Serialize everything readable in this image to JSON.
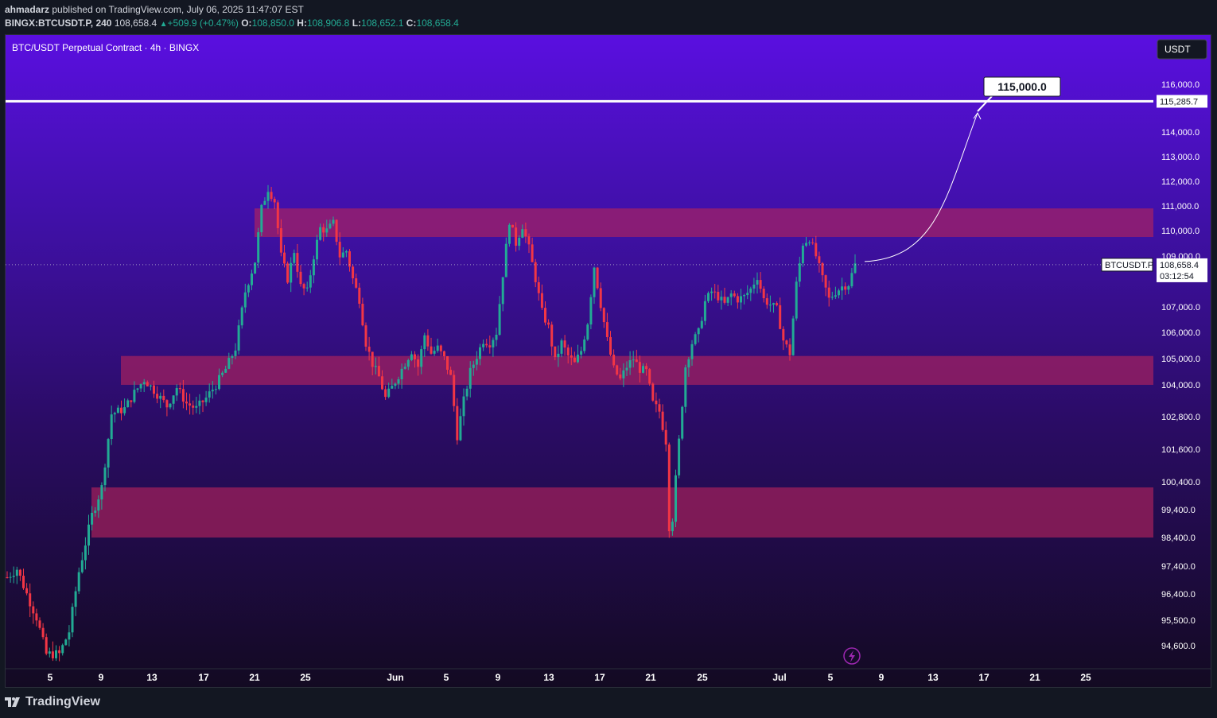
{
  "header": {
    "publisher": "ahmadarz",
    "published_text": "published on TradingView.com, July 06, 2025 11:47:07 EST",
    "symbol_line": "BINGX:BTCUSDT.P, 240",
    "last": "108,658.4",
    "change": "+509.9 (+0.47%)",
    "o_label": "O:",
    "o": "108,850.0",
    "h_label": "H:",
    "h": "108,906.8",
    "l_label": "L:",
    "l": "108,652.1",
    "c_label": "C:",
    "c": "108,658.4"
  },
  "chart_data": {
    "type": "candlestick",
    "title": "BTC/USDT Perpetual Contract · 4h · BINGX",
    "currency_button": "USDT",
    "price_axis_labels": [
      "116,000.0",
      "114,000.0",
      "113,000.0",
      "112,000.0",
      "111,000.0",
      "110,000.0",
      "109,000.0",
      "107,000.0",
      "106,000.0",
      "105,000.0",
      "104,000.0",
      "102,800.0",
      "101,600.0",
      "100,400.0",
      "99,400.0",
      "98,400.0",
      "97,400.0",
      "96,400.0",
      "95,500.0",
      "94,600.0"
    ],
    "time_axis_labels": [
      "5",
      "9",
      "13",
      "17",
      "21",
      "25",
      "Jun",
      "5",
      "9",
      "13",
      "17",
      "21",
      "25",
      "Jul",
      "5",
      "9",
      "13",
      "17",
      "21",
      "25"
    ],
    "horizontal_line": {
      "price": 115285.7,
      "label": "115,285.7"
    },
    "current_price": {
      "symbol": "BTCUSDT.P",
      "price": "108,658.4",
      "countdown": "03:12:54"
    },
    "target_callout": {
      "price": 115000,
      "label": "115,000.0"
    },
    "zones": [
      {
        "from": 109750,
        "to": 110900
      },
      {
        "from": 104000,
        "to": 105100
      },
      {
        "from": 98400,
        "to": 100200
      }
    ],
    "price_path": [
      [
        0,
        97000
      ],
      [
        3,
        97300
      ],
      [
        6,
        96400
      ],
      [
        9,
        95600
      ],
      [
        12,
        94300
      ],
      [
        16,
        94300
      ],
      [
        19,
        95100
      ],
      [
        22,
        97200
      ],
      [
        26,
        99200
      ],
      [
        29,
        100200
      ],
      [
        32,
        102900
      ],
      [
        36,
        103100
      ],
      [
        39,
        103700
      ],
      [
        42,
        104200
      ],
      [
        45,
        103800
      ],
      [
        49,
        103200
      ],
      [
        52,
        103900
      ],
      [
        55,
        103300
      ],
      [
        58,
        103100
      ],
      [
        61,
        103500
      ],
      [
        64,
        104000
      ],
      [
        67,
        104600
      ],
      [
        70,
        105400
      ],
      [
        73,
        107600
      ],
      [
        76,
        108800
      ],
      [
        78,
        110900
      ],
      [
        80,
        111700
      ],
      [
        82,
        111200
      ],
      [
        84,
        109000
      ],
      [
        86,
        108100
      ],
      [
        88,
        109200
      ],
      [
        90,
        107800
      ],
      [
        92,
        107600
      ],
      [
        94,
        109000
      ],
      [
        96,
        110100
      ],
      [
        98,
        110000
      ],
      [
        100,
        110300
      ],
      [
        102,
        109000
      ],
      [
        104,
        109200
      ],
      [
        106,
        108100
      ],
      [
        108,
        107300
      ],
      [
        110,
        105600
      ],
      [
        112,
        104800
      ],
      [
        114,
        104300
      ],
      [
        116,
        103500
      ],
      [
        118,
        103900
      ],
      [
        121,
        104600
      ],
      [
        124,
        105300
      ],
      [
        126,
        104700
      ],
      [
        128,
        105900
      ],
      [
        130,
        105200
      ],
      [
        132,
        105400
      ],
      [
        134,
        105000
      ],
      [
        136,
        104300
      ],
      [
        138,
        102100
      ],
      [
        140,
        103400
      ],
      [
        142,
        104500
      ],
      [
        144,
        105100
      ],
      [
        146,
        105700
      ],
      [
        148,
        105600
      ],
      [
        150,
        106000
      ],
      [
        152,
        108300
      ],
      [
        154,
        110400
      ],
      [
        156,
        109500
      ],
      [
        158,
        110200
      ],
      [
        160,
        109300
      ],
      [
        162,
        108100
      ],
      [
        164,
        106800
      ],
      [
        166,
        106200
      ],
      [
        168,
        104900
      ],
      [
        170,
        105600
      ],
      [
        172,
        105100
      ],
      [
        174,
        104800
      ],
      [
        176,
        105300
      ],
      [
        178,
        106400
      ],
      [
        180,
        108600
      ],
      [
        182,
        107100
      ],
      [
        184,
        105700
      ],
      [
        186,
        104600
      ],
      [
        188,
        104200
      ],
      [
        190,
        104700
      ],
      [
        192,
        105000
      ],
      [
        194,
        104600
      ],
      [
        196,
        104500
      ],
      [
        198,
        103300
      ],
      [
        200,
        103000
      ],
      [
        202,
        101900
      ],
      [
        203,
        98800
      ],
      [
        204,
        99100
      ],
      [
        206,
        101900
      ],
      [
        208,
        104700
      ],
      [
        210,
        105600
      ],
      [
        212,
        106000
      ],
      [
        214,
        107200
      ],
      [
        216,
        107600
      ],
      [
        218,
        107400
      ],
      [
        220,
        107100
      ],
      [
        222,
        107500
      ],
      [
        224,
        107300
      ],
      [
        226,
        107400
      ],
      [
        228,
        107700
      ],
      [
        230,
        108200
      ],
      [
        232,
        107300
      ],
      [
        234,
        107100
      ],
      [
        236,
        106900
      ],
      [
        238,
        105700
      ],
      [
        240,
        105200
      ],
      [
        242,
        107900
      ],
      [
        244,
        109500
      ],
      [
        246,
        109700
      ],
      [
        248,
        109000
      ],
      [
        250,
        108100
      ],
      [
        252,
        107300
      ],
      [
        254,
        107600
      ],
      [
        256,
        107800
      ],
      [
        258,
        107900
      ],
      [
        260,
        108658
      ]
    ]
  },
  "footer": {
    "brand": "TradingView"
  }
}
